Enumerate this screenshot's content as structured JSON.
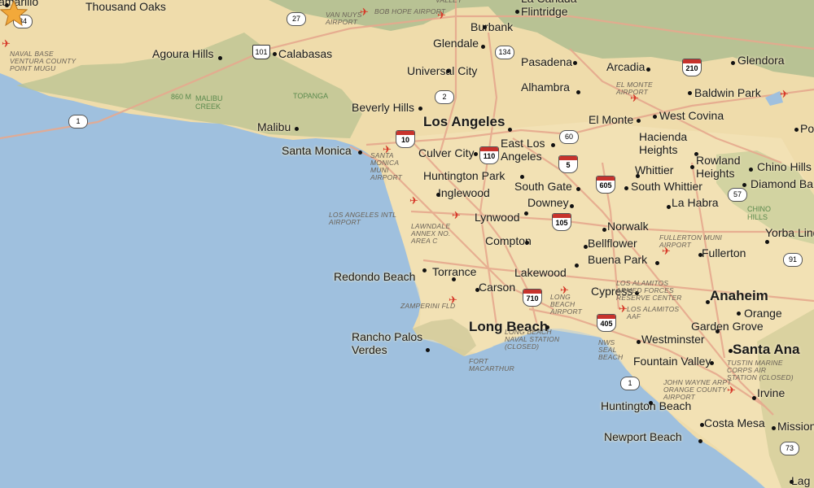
{
  "map": {
    "cities_large": [
      {
        "name": "Los Angeles"
      },
      {
        "name": "Long Beach"
      },
      {
        "name": "Anaheim"
      },
      {
        "name": "Santa Ana"
      }
    ],
    "cities": [
      {
        "name": "Camarillo"
      },
      {
        "name": "Thousand Oaks"
      },
      {
        "name": "Burbank"
      },
      {
        "name": "Glendale"
      },
      {
        "name": "La Cañada Flintridge"
      },
      {
        "name": "Agoura Hills"
      },
      {
        "name": "Calabasas"
      },
      {
        "name": "Pasadena"
      },
      {
        "name": "Arcadia"
      },
      {
        "name": "Glendora"
      },
      {
        "name": "Universal City"
      },
      {
        "name": "Alhambra"
      },
      {
        "name": "Baldwin Park"
      },
      {
        "name": "Beverly Hills"
      },
      {
        "name": "El Monte"
      },
      {
        "name": "West Covina"
      },
      {
        "name": "Malibu"
      },
      {
        "name": "Hacienda Heights"
      },
      {
        "name": "Santa Monica"
      },
      {
        "name": "Culver City"
      },
      {
        "name": "East Los Angeles"
      },
      {
        "name": "Rowland Heights"
      },
      {
        "name": "Whittier"
      },
      {
        "name": "Chino Hills"
      },
      {
        "name": "Huntington Park"
      },
      {
        "name": "South Gate"
      },
      {
        "name": "South Whittier"
      },
      {
        "name": "Diamond Bar"
      },
      {
        "name": "Inglewood"
      },
      {
        "name": "Downey"
      },
      {
        "name": "La Habra"
      },
      {
        "name": "Lynwood"
      },
      {
        "name": "Norwalk"
      },
      {
        "name": "Yorba Linda"
      },
      {
        "name": "Compton"
      },
      {
        "name": "Bellflower"
      },
      {
        "name": "Fullerton"
      },
      {
        "name": "Buena Park"
      },
      {
        "name": "Redondo Beach"
      },
      {
        "name": "Torrance"
      },
      {
        "name": "Lakewood"
      },
      {
        "name": "Carson"
      },
      {
        "name": "Cypress"
      },
      {
        "name": "Orange"
      },
      {
        "name": "Garden Grove"
      },
      {
        "name": "Rancho Palos Verdes"
      },
      {
        "name": "Westminster"
      },
      {
        "name": "Fountain Valley"
      },
      {
        "name": "Irvine"
      },
      {
        "name": "Huntington Beach"
      },
      {
        "name": "Costa Mesa"
      },
      {
        "name": "Mission"
      },
      {
        "name": "Newport Beach"
      },
      {
        "name": "Lag"
      },
      {
        "name": "Po"
      }
    ],
    "pois": [
      {
        "name": "Naval Base Ventura County Point Mugu"
      },
      {
        "name": "Van Nuys Airport"
      },
      {
        "name": "Bob Hope Airport"
      },
      {
        "name": "Valley"
      },
      {
        "name": "El Monte Airport"
      },
      {
        "name": "Santa Monica Muni Airport"
      },
      {
        "name": "Los Angeles Intl Airport"
      },
      {
        "name": "Lawndale Annex No. Area C"
      },
      {
        "name": "Fullerton Muni Airport"
      },
      {
        "name": "Long Beach Airport"
      },
      {
        "name": "Los Alamitos Armed Forces Reserve Center"
      },
      {
        "name": "Los Alamitos AAF"
      },
      {
        "name": "Zamperini Fld"
      },
      {
        "name": "Long Beach Naval Station (Closed)"
      },
      {
        "name": "Fort MacArthur"
      },
      {
        "name": "NWS Seal Beach"
      },
      {
        "name": "Tustin Marine Corps Air Station (Closed)"
      },
      {
        "name": "John Wayne Arpt Orange County Airport"
      }
    ],
    "parks": [
      {
        "name": "Malibu Creek"
      },
      {
        "name": "Topanga"
      },
      {
        "name": "Chino Hills"
      },
      {
        "name": "860 m"
      }
    ],
    "routes": {
      "interstates": [
        "10",
        "110",
        "5",
        "605",
        "105",
        "710",
        "405",
        "210"
      ],
      "us_routes": [
        "101"
      ],
      "state_routes": [
        "34",
        "27",
        "134",
        "2",
        "1",
        "60",
        "57",
        "91",
        "1",
        "73"
      ]
    },
    "marker": {
      "type": "star",
      "color": "#f2a93a"
    },
    "colors": {
      "water": "#9fc0de",
      "land": "#efdcab",
      "hills": "#dccb98",
      "mountains": "#a8b88c",
      "roads": "#e7b39a",
      "airport": "#d63a2a"
    }
  }
}
